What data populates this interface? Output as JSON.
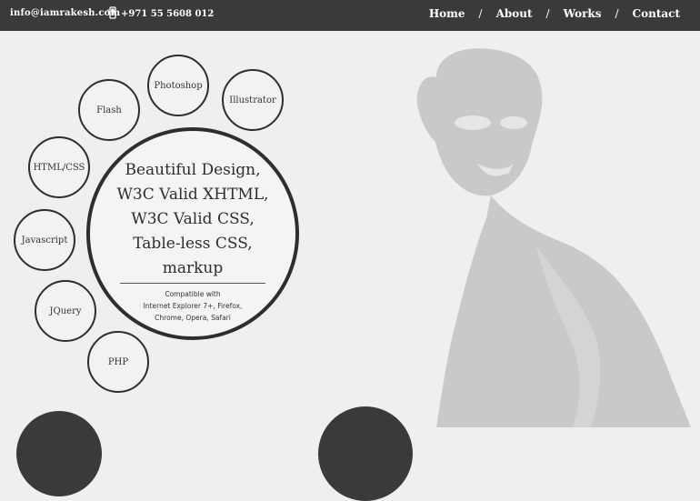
{
  "header": {
    "email": "info@iamrakesh.com",
    "phone": "+971 55 5608 012",
    "nav": [
      "Home",
      "About",
      "Works",
      "Contact"
    ],
    "separator": "/"
  },
  "skills": [
    "Photoshop",
    "Illustrator",
    "Flash",
    "HTML/CSS",
    "Javascript",
    "JQuery",
    "PHP"
  ],
  "feature": {
    "lines": [
      "Beautiful Design,",
      "W3C Valid XHTML,",
      "W3C Valid CSS,",
      "Table-less CSS,",
      "markup"
    ],
    "compat_lines": [
      "Compatible with",
      "Internet Explorer 7+, Firefox,",
      "Chrome, Opera, Safari"
    ]
  },
  "icons": {
    "phone": "mobile-phone-icon"
  },
  "colors": {
    "topbar": "#3a3a3a",
    "background": "#efefef",
    "ring": "#2e2e2e"
  }
}
